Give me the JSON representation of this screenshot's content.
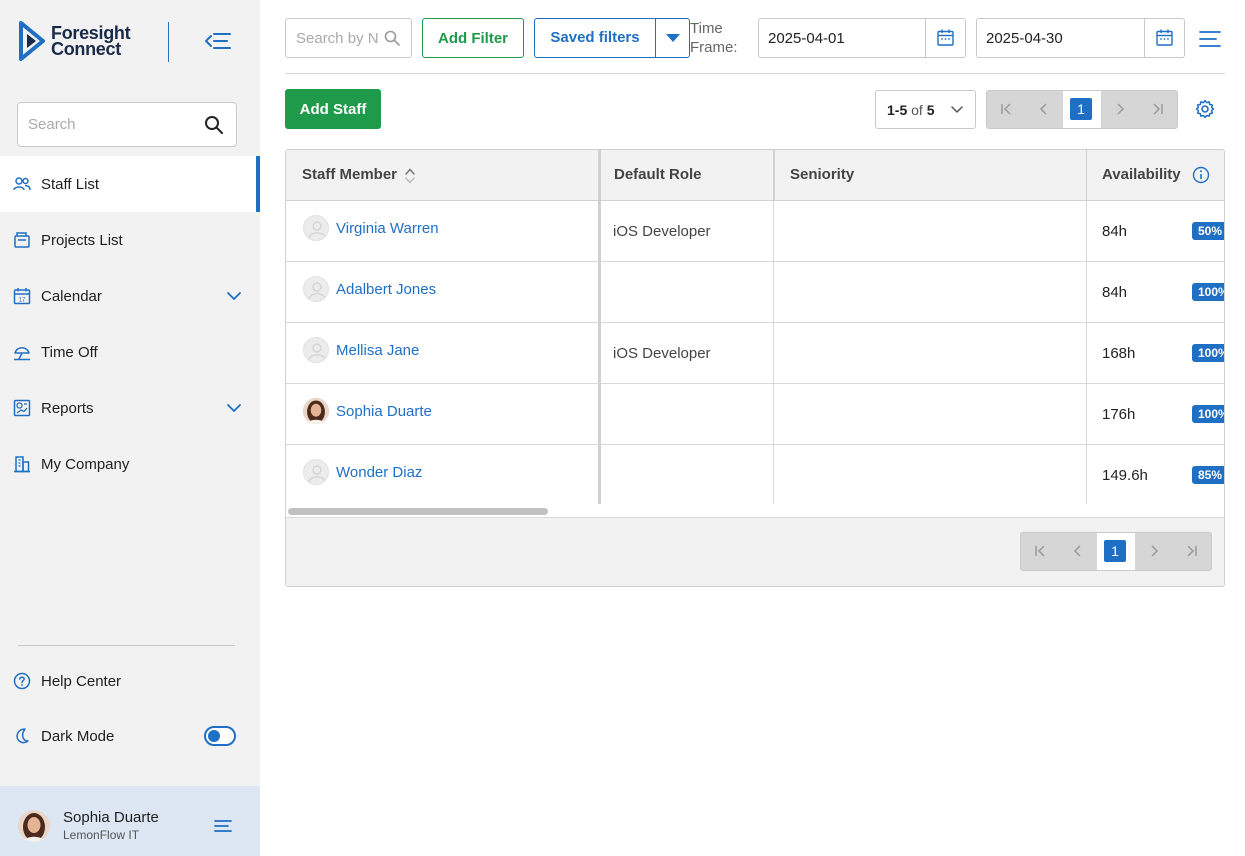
{
  "brand": {
    "line1": "Foresight",
    "line2": "Connect",
    "color": "#1f6fc5"
  },
  "sidebar": {
    "search_placeholder": "Search",
    "items": [
      {
        "label": "Staff List",
        "icon": "people-icon",
        "active": true
      },
      {
        "label": "Projects List",
        "icon": "projects-icon"
      },
      {
        "label": "Calendar",
        "icon": "calendar-icon",
        "expandable": true
      },
      {
        "label": "Time Off",
        "icon": "time-off-icon"
      },
      {
        "label": "Reports",
        "icon": "reports-icon",
        "expandable": true
      },
      {
        "label": "My Company",
        "icon": "building-icon"
      }
    ],
    "help_label": "Help Center",
    "dark_mode_label": "Dark Mode",
    "dark_mode_on": true
  },
  "user": {
    "name": "Sophia Duarte",
    "company": "LemonFlow IT"
  },
  "topbar": {
    "search_placeholder": "Search by Name",
    "add_filter_label": "Add Filter",
    "saved_filters_label": "Saved filters",
    "timeframe_label": "Time Frame:",
    "date_start": "2025-04-01",
    "date_end": "2025-04-30"
  },
  "toolbar": {
    "add_staff_label": "Add Staff",
    "range": "1-5",
    "of_word": "of",
    "total": "5",
    "current_page": "1"
  },
  "table": {
    "columns": [
      "Staff Member",
      "Default Role",
      "Seniority",
      "Availability"
    ],
    "rows": [
      {
        "name": "Virginia Warren",
        "role": "iOS Developer",
        "seniority": "",
        "hours": "84h",
        "percent": "50%",
        "photo": false
      },
      {
        "name": "Adalbert Jones",
        "role": "",
        "seniority": "",
        "hours": "84h",
        "percent": "100%",
        "photo": false
      },
      {
        "name": "Mellisa Jane",
        "role": "iOS Developer",
        "seniority": "",
        "hours": "168h",
        "percent": "100%",
        "photo": false
      },
      {
        "name": "Sophia Duarte",
        "role": "",
        "seniority": "",
        "hours": "176h",
        "percent": "100%",
        "photo": true
      },
      {
        "name": "Wonder Diaz",
        "role": "",
        "seniority": "",
        "hours": "149.6h",
        "percent": "85%",
        "photo": false
      }
    ]
  },
  "colors": {
    "primary": "#1f6fc5",
    "success": "#1e9a4a",
    "sidebar_bg": "#f2f2f2",
    "user_panel_bg": "#dde7f4"
  }
}
